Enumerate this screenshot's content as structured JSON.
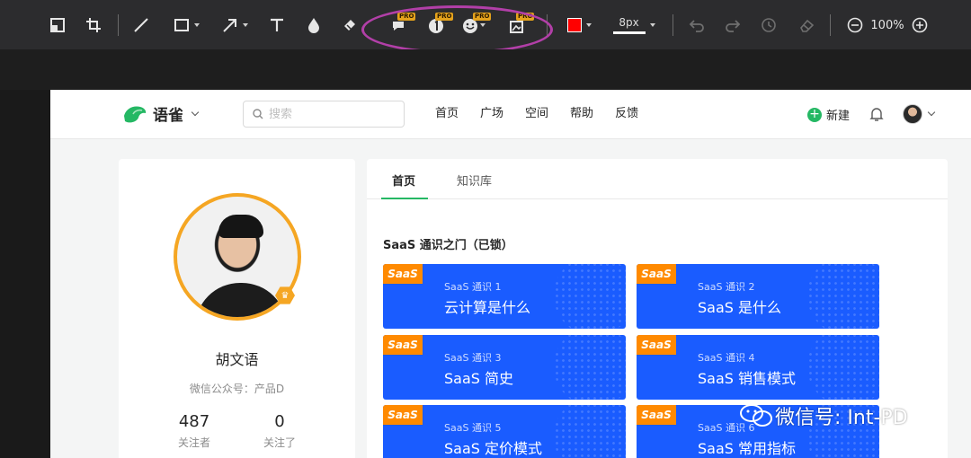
{
  "toolbar": {
    "tools": [
      {
        "name": "select-area"
      },
      {
        "name": "crop"
      },
      {
        "name": "line"
      },
      {
        "name": "rectangle"
      },
      {
        "name": "arrow"
      },
      {
        "name": "text"
      },
      {
        "name": "blur-drop"
      },
      {
        "name": "highlighter"
      },
      {
        "name": "callout",
        "badge": "PRO"
      },
      {
        "name": "number-step",
        "badge": "PRO"
      },
      {
        "name": "emoji",
        "badge": "PRO"
      },
      {
        "name": "magic-image",
        "badge": "PRO"
      }
    ],
    "color": "#ff0000",
    "pen_size": "8px",
    "zoom": "100%",
    "highlight_color": "#b23fa8"
  },
  "yuque": {
    "logo_text": "语雀",
    "search_placeholder": "搜索",
    "nav": [
      "首页",
      "广场",
      "空间",
      "帮助",
      "反馈"
    ],
    "new_label": "新建",
    "profile": {
      "name": "胡文语",
      "subtitle": "微信公众号：产品D",
      "followers": "487",
      "followers_label": "关注者",
      "following": "0",
      "following_label": "关注了"
    },
    "tabs": [
      "首页",
      "知识库"
    ],
    "section_title": "SaaS 通识之门（已锁）",
    "badge_text": "SaaS",
    "courses": [
      {
        "sub": "SaaS 通识 1",
        "title": "云计算是什么"
      },
      {
        "sub": "SaaS 通识 2",
        "title": "SaaS 是什么"
      },
      {
        "sub": "SaaS 通识 3",
        "title": "SaaS 简史"
      },
      {
        "sub": "SaaS 通识 4",
        "title": "SaaS 销售模式"
      },
      {
        "sub": "SaaS 通识 5",
        "title": "SaaS 定价模式"
      },
      {
        "sub": "SaaS 通识 6",
        "title": "SaaS 常用指标"
      }
    ],
    "brand_color": "#25b864",
    "card_color": "#1a5cff"
  },
  "watermark": "微信号: Int-PD"
}
